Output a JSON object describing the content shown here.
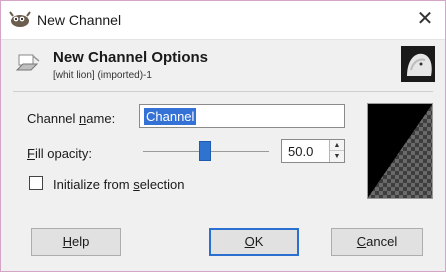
{
  "window": {
    "title": "New Channel",
    "close_symbol": "✕"
  },
  "header": {
    "title": "New Channel Options",
    "subtitle": "[whit lion] (imported)-1"
  },
  "form": {
    "channel_name_label_pre": "Channel ",
    "channel_name_label_mn": "n",
    "channel_name_label_post": "ame:",
    "channel_name_value": "Channel",
    "fill_opacity_label_mn": "F",
    "fill_opacity_label_post": "ill opacity:",
    "fill_opacity_value": "50.0",
    "fill_opacity_fraction": 0.5,
    "init_from_selection_pre": "Initialize from ",
    "init_from_selection_mn": "s",
    "init_from_selection_post": "election",
    "init_from_selection_checked": false
  },
  "buttons": {
    "help_mn": "H",
    "help_post": "elp",
    "ok_mn": "O",
    "ok_post": "K",
    "cancel_mn": "C",
    "cancel_post": "ancel"
  },
  "colors": {
    "accent": "#3572d6",
    "preview_dark": "#000000",
    "checker": "#5a5a5a"
  }
}
